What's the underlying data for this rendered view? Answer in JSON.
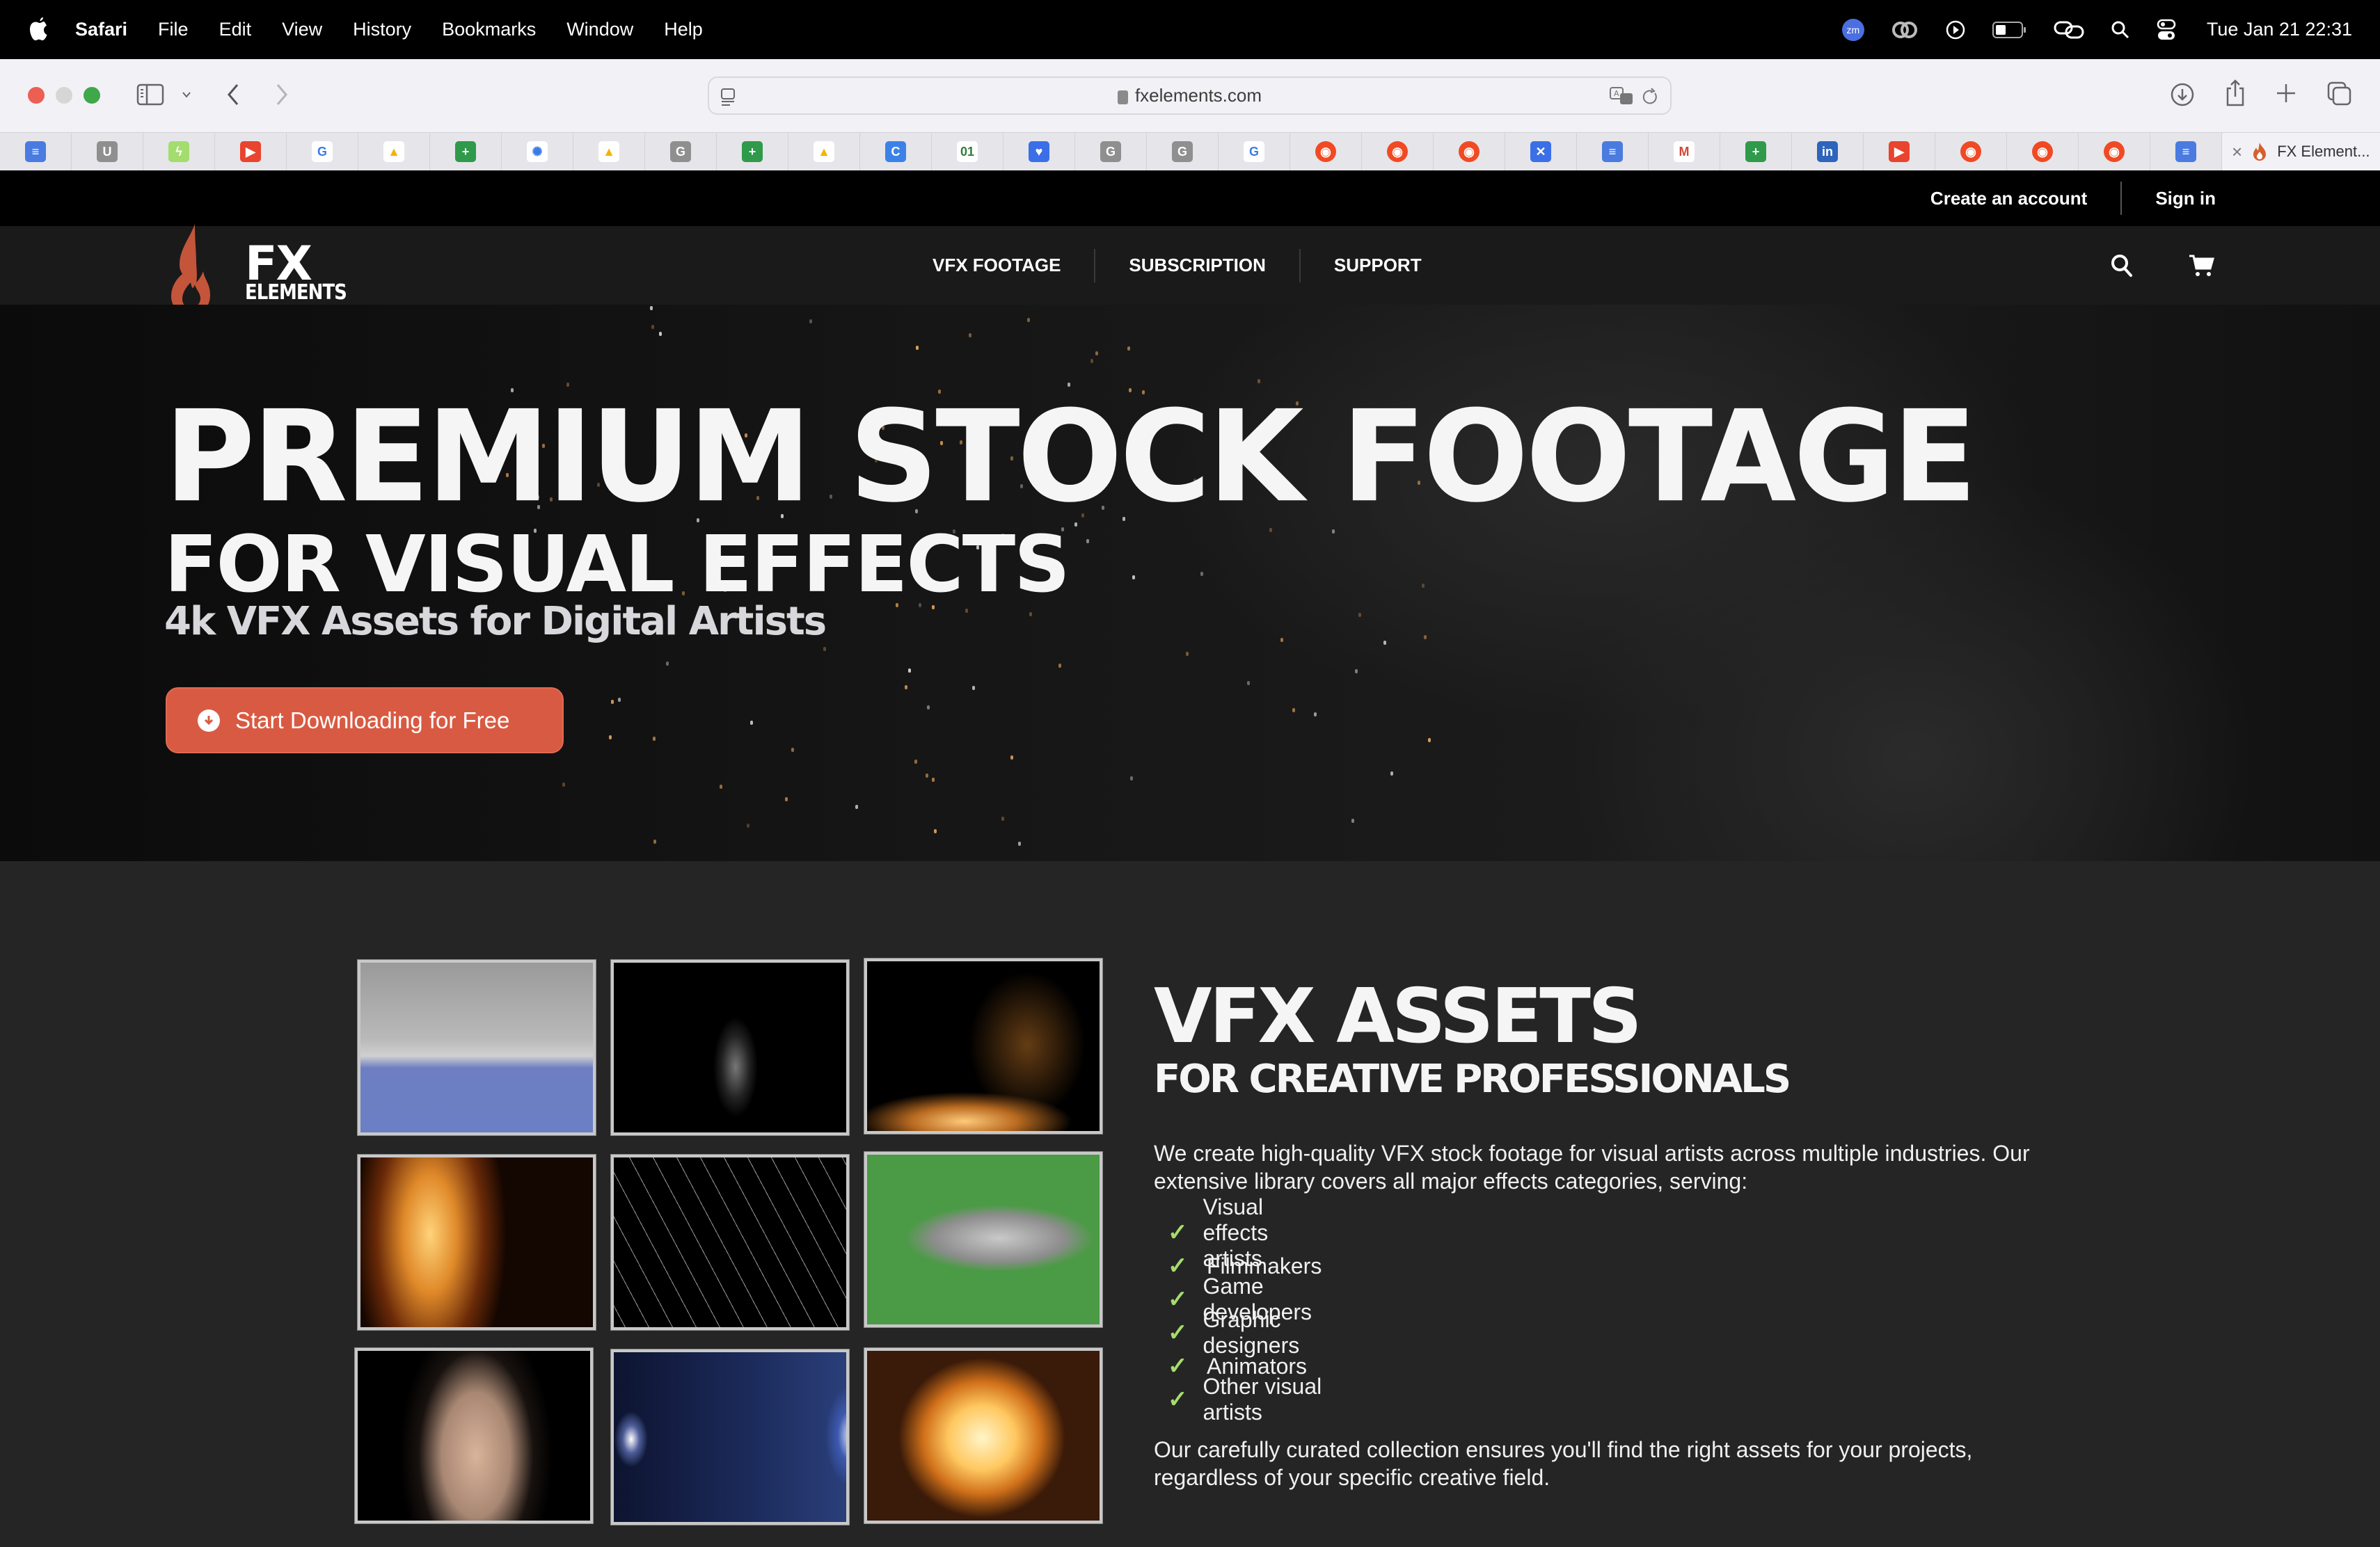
{
  "menubar": {
    "app": "Safari",
    "items": [
      "File",
      "Edit",
      "View",
      "History",
      "Bookmarks",
      "Window",
      "Help"
    ],
    "status_icons": [
      "zoom-icon",
      "creative-cloud-icon",
      "play-icon",
      "battery-icon",
      "link-icon",
      "spotlight-icon",
      "control-center-icon"
    ],
    "zoom_label": "zm",
    "clock": "Tue Jan 21  22:31"
  },
  "browser": {
    "url": "fxelements.com",
    "tabs": [
      {
        "icon": "google-docs",
        "label": "",
        "color": "#4a7be0",
        "glyph": "≡"
      },
      {
        "icon": "generic-u",
        "label": "",
        "color": "#8f8f8f",
        "glyph": "U"
      },
      {
        "icon": "bolt-app",
        "label": "",
        "color": "#a3dd6d",
        "glyph": "ϟ"
      },
      {
        "icon": "youtube",
        "label": "",
        "color": "#e8442e",
        "glyph": "▶"
      },
      {
        "icon": "google",
        "label": "",
        "color": "#ffffff",
        "glyph": "G"
      },
      {
        "icon": "google-drive",
        "label": "",
        "color": "#ffffff",
        "glyph": "▲"
      },
      {
        "icon": "google-sheets",
        "label": "",
        "color": "#2f9a4a",
        "glyph": "+"
      },
      {
        "icon": "chatgpt",
        "label": "",
        "color": "#ffffff",
        "glyph": "✺"
      },
      {
        "icon": "google-drive",
        "label": "",
        "color": "#ffffff",
        "glyph": "▲"
      },
      {
        "icon": "generic-g",
        "label": "",
        "color": "#8f8f8f",
        "glyph": "G"
      },
      {
        "icon": "google-sheets",
        "label": "",
        "color": "#2f9a4a",
        "glyph": "+"
      },
      {
        "icon": "google-drive",
        "label": "",
        "color": "#ffffff",
        "glyph": "▲"
      },
      {
        "icon": "canva",
        "label": "",
        "color": "#3b82e8",
        "glyph": "C"
      },
      {
        "icon": "clock-app",
        "label": "",
        "color": "#ffffff",
        "glyph": "01"
      },
      {
        "icon": "heart-chat",
        "label": "",
        "color": "#3b6fe8",
        "glyph": "♥"
      },
      {
        "icon": "generic-g",
        "label": "",
        "color": "#8f8f8f",
        "glyph": "G"
      },
      {
        "icon": "generic-g",
        "label": "",
        "color": "#8f8f8f",
        "glyph": "G"
      },
      {
        "icon": "google",
        "label": "",
        "color": "#ffffff",
        "glyph": "G"
      },
      {
        "icon": "reddit",
        "label": "",
        "color": "#f04a24",
        "glyph": "◉"
      },
      {
        "icon": "reddit",
        "label": "",
        "color": "#f04a24",
        "glyph": "◉"
      },
      {
        "icon": "reddit",
        "label": "",
        "color": "#f04a24",
        "glyph": "◉"
      },
      {
        "icon": "translate-app",
        "label": "",
        "color": "#3b6fe8",
        "glyph": "✕"
      },
      {
        "icon": "google-docs",
        "label": "",
        "color": "#4a7be0",
        "glyph": "≡"
      },
      {
        "icon": "gmail",
        "label": "",
        "color": "#ffffff",
        "glyph": "M"
      },
      {
        "icon": "google-sheets",
        "label": "",
        "color": "#2f9a4a",
        "glyph": "+"
      },
      {
        "icon": "linkedin",
        "label": "",
        "color": "#2d64bc",
        "glyph": "in"
      },
      {
        "icon": "youtube",
        "label": "",
        "color": "#e8442e",
        "glyph": "▶"
      },
      {
        "icon": "reddit",
        "label": "",
        "color": "#f04a24",
        "glyph": "◉"
      },
      {
        "icon": "reddit",
        "label": "",
        "color": "#f04a24",
        "glyph": "◉"
      },
      {
        "icon": "reddit",
        "label": "",
        "color": "#f04a24",
        "glyph": "◉"
      },
      {
        "icon": "google-docs",
        "label": "",
        "color": "#4a7be0",
        "glyph": "≡"
      }
    ],
    "active_tab": {
      "icon": "fx-elements-flame",
      "label": "FX Element..."
    }
  },
  "site": {
    "account": {
      "create": "Create an account",
      "signin": "Sign in"
    },
    "logo": {
      "line1": "FX",
      "line2": "ELEMENTS"
    },
    "nav": [
      "VFX FOOTAGE",
      "SUBSCRIPTION",
      "SUPPORT"
    ],
    "hero": {
      "title": "PREMIUM STOCK FOOTAGE",
      "subtitle": "FOR VISUAL EFFECTS",
      "tagline": "4k VFX Assets for Digital Artists",
      "cta": "Start Downloading for Free"
    },
    "assets": {
      "title": "VFX ASSETS",
      "subtitle": "FOR CREATIVE PROFESSIONALS",
      "intro": "We create high-quality VFX stock footage for visual artists across multiple industries. Our extensive library covers all major effects categories, serving:",
      "audience": [
        "Visual effects artists",
        "Filmmakers",
        "Game developers",
        "Graphic designers",
        "Animators",
        "Other visual artists"
      ],
      "outro": "Our carefully curated collection ensures you'll find the right assets for your projects, regardless of your specific creative field.",
      "thumbnails": [
        "smoke-cloud-bluescreen",
        "smoke-wisp",
        "sparks",
        "fire",
        "shattered-glass",
        "smoke-greenscreen",
        "dust-explosion",
        "lens-flare",
        "fireball"
      ]
    },
    "colors": {
      "accent": "#d95a42",
      "check": "#a6dc6c",
      "flame": "#c4553a"
    }
  }
}
